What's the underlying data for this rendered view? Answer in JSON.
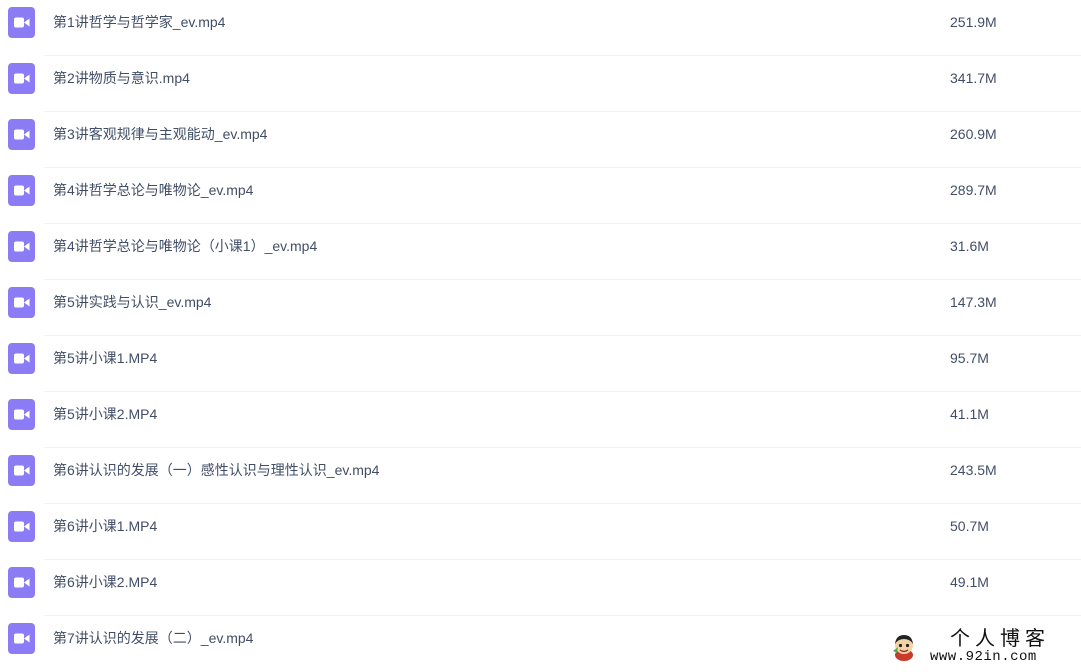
{
  "theme": {
    "accent": "#8b7cf6",
    "text": "#424e67",
    "row_divider": "#f1f2f4"
  },
  "file_list": {
    "icon": "video-file-icon",
    "items": [
      {
        "name": "第1讲哲学与哲学家_ev.mp4",
        "size": "251.9M"
      },
      {
        "name": "第2讲物质与意识.mp4",
        "size": "341.7M"
      },
      {
        "name": "第3讲客观规律与主观能动_ev.mp4",
        "size": "260.9M"
      },
      {
        "name": "第4讲哲学总论与唯物论_ev.mp4",
        "size": "289.7M"
      },
      {
        "name": "第4讲哲学总论与唯物论（小课1）_ev.mp4",
        "size": "31.6M"
      },
      {
        "name": "第5讲实践与认识_ev.mp4",
        "size": "147.3M"
      },
      {
        "name": "第5讲小课1.MP4",
        "size": "95.7M"
      },
      {
        "name": "第5讲小课2.MP4",
        "size": "41.1M"
      },
      {
        "name": "第6讲认识的发展（一）感性认识与理性认识_ev.mp4",
        "size": "243.5M"
      },
      {
        "name": "第6讲小课1.MP4",
        "size": "50.7M"
      },
      {
        "name": "第6讲小课2.MP4",
        "size": "49.1M"
      },
      {
        "name": "第7讲认识的发展（二）_ev.mp4",
        "size": ""
      }
    ]
  },
  "watermark": {
    "title": "个人博客",
    "url": "www.92in.com",
    "icon": "cartoon-avatar-icon"
  }
}
